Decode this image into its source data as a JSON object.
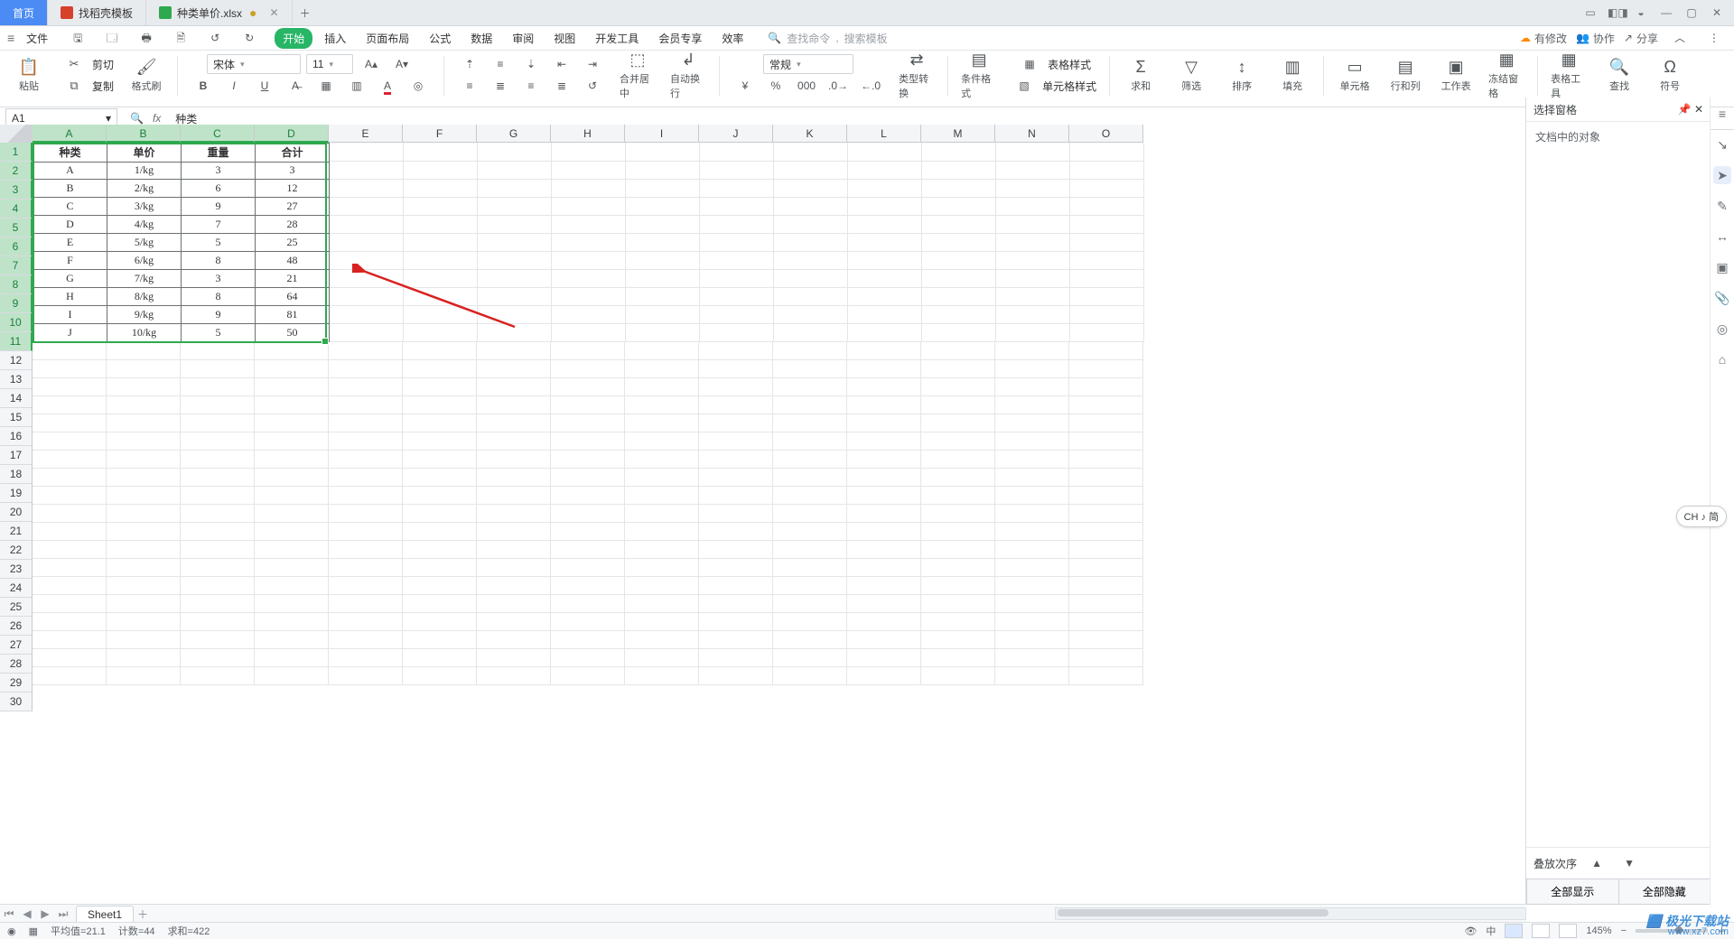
{
  "window": {
    "tab_home": "首页",
    "tab_template": "找稻壳模板",
    "tab_doc": "种类单价.xlsx",
    "ime_badge": "CH ♪ 简"
  },
  "menu": {
    "file": "文件",
    "tabs": [
      "开始",
      "插入",
      "页面布局",
      "公式",
      "数据",
      "审阅",
      "视图",
      "开发工具",
      "会员专享",
      "效率"
    ],
    "search_placeholder_cmd": "查找命令",
    "search_placeholder_tpl": "搜索模板",
    "right": {
      "changes": "有修改",
      "coop": "协作",
      "share": "分享"
    }
  },
  "ribbon": {
    "paste": "粘贴",
    "cut": "剪切",
    "copy": "复制",
    "format_painter": "格式刷",
    "font_name": "宋体",
    "font_size": "11",
    "merge_center": "合并居中",
    "wrap": "自动换行",
    "number_format": "常规",
    "type_convert": "类型转换",
    "cond_format": "条件格式",
    "table_style": "表格样式",
    "cell_style": "单元格样式",
    "sum": "求和",
    "filter": "筛选",
    "sort": "排序",
    "fill": "填充",
    "cells": "单元格",
    "rows_cols": "行和列",
    "worksheet": "工作表",
    "freeze": "冻结窗格",
    "table_tools": "表格工具",
    "find": "查找",
    "symbol": "符号"
  },
  "fx": {
    "cell_ref": "A1",
    "value": "种类"
  },
  "sheet": {
    "columns": [
      "A",
      "B",
      "C",
      "D",
      "E",
      "F",
      "G",
      "H",
      "I",
      "J",
      "K",
      "L",
      "M",
      "N",
      "O"
    ],
    "sel_cols": 4,
    "rows": 30,
    "sel_rows": 11,
    "headers": [
      "种类",
      "单价",
      "重量",
      "合计"
    ],
    "data": [
      [
        "A",
        "1/kg",
        "3",
        "3"
      ],
      [
        "B",
        "2/kg",
        "6",
        "12"
      ],
      [
        "C",
        "3/kg",
        "9",
        "27"
      ],
      [
        "D",
        "4/kg",
        "7",
        "28"
      ],
      [
        "E",
        "5/kg",
        "5",
        "25"
      ],
      [
        "F",
        "6/kg",
        "8",
        "48"
      ],
      [
        "G",
        "7/kg",
        "3",
        "21"
      ],
      [
        "H",
        "8/kg",
        "8",
        "64"
      ],
      [
        "I",
        "9/kg",
        "9",
        "81"
      ],
      [
        "J",
        "10/kg",
        "5",
        "50"
      ]
    ],
    "tabs": {
      "sheet1": "Sheet1"
    }
  },
  "taskpane": {
    "title": "选择窗格",
    "section": "文档中的对象",
    "stack_label": "叠放次序",
    "show_all": "全部显示",
    "hide_all": "全部隐藏"
  },
  "status": {
    "avg_label": "平均值=",
    "avg_val": "21.1",
    "count_label": "计数=",
    "count_val": "44",
    "sum_label": "求和=",
    "sum_val": "422",
    "zoom": "145%"
  },
  "watermark": {
    "brand": "极光下载站",
    "url": "www.xz7.com"
  }
}
